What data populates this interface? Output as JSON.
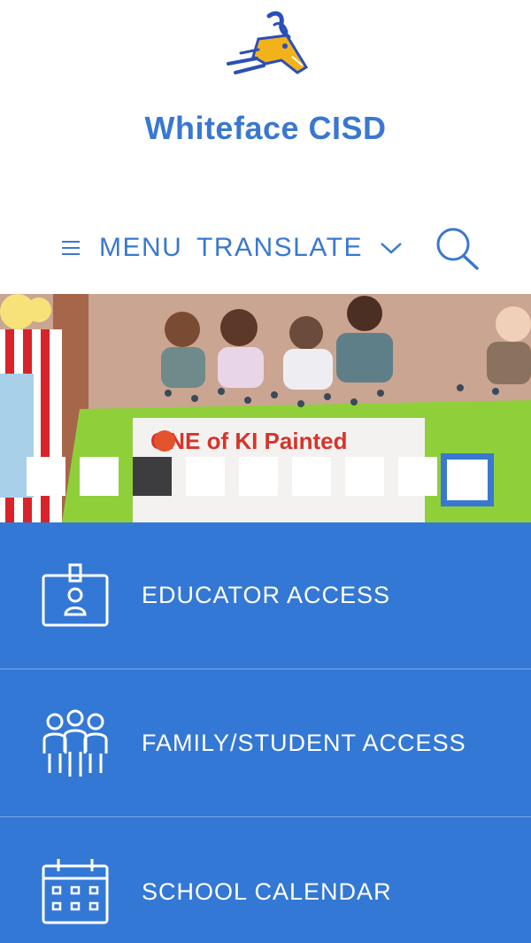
{
  "header": {
    "logo_icon": "antelope-mascot-logo",
    "title": "Whiteface CISD"
  },
  "nav": {
    "menu_label": "MENU",
    "translate_label": "TRANSLATE",
    "icons": [
      "hamburger-icon",
      "chevron-down-icon",
      "search-icon"
    ]
  },
  "hero": {
    "description_icon": "slideshow-photo",
    "banner_text": "ONE of KI Painted",
    "slide_count": 9,
    "current_slide": 9,
    "dark_slide": 3
  },
  "quick_links": [
    {
      "label": "EDUCATOR ACCESS",
      "icon": "id-badge-icon"
    },
    {
      "label": "FAMILY/STUDENT ACCESS",
      "icon": "family-icon"
    },
    {
      "label": "SCHOOL CALENDAR",
      "icon": "calendar-icon"
    }
  ],
  "colors": {
    "brand_blue": "#3a78cf",
    "panel_blue": "#3478d5",
    "logo_gold": "#f2b21c"
  }
}
